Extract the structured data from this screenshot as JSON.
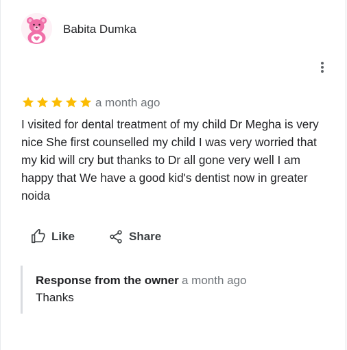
{
  "review": {
    "author_name": "Babita Dumka",
    "rating": 5,
    "max_rating": 5,
    "date": "a month ago",
    "text": "I visited for dental treatment of my child Dr Megha is very nice She first counselled my child I was very worried that my kid will cry but thanks to Dr all gone very well I am happy that We have a good kid's dentist now in greater noida"
  },
  "actions": {
    "like_label": "Like",
    "share_label": "Share"
  },
  "owner_response": {
    "title": "Response from the owner",
    "date": "a month ago",
    "text": "Thanks"
  },
  "icons": {
    "avatar": "pink-teddy-bear-avatar",
    "more": "more-vert-icon",
    "star": "star-icon",
    "like": "thumb-up-icon",
    "share": "share-icon"
  },
  "colors": {
    "star": "#fbbc04",
    "secondary_text": "#70757a",
    "avatar_pink": "#f06fa8"
  }
}
